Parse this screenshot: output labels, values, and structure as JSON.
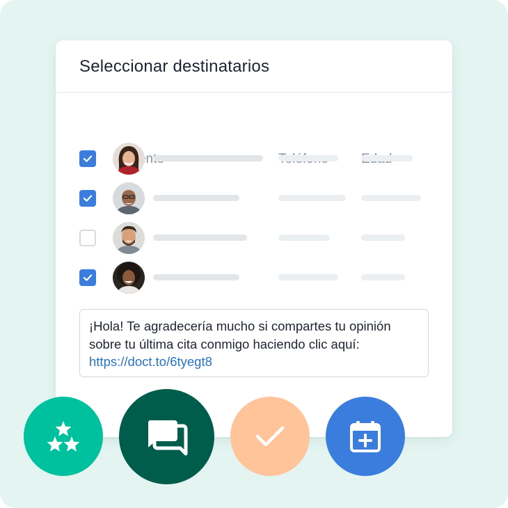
{
  "card": {
    "title": "Seleccionar destinatarios"
  },
  "table": {
    "headers": {
      "patient": "Paciente",
      "phone": "Teléfono",
      "age": "Edad"
    },
    "rows": [
      {
        "checked": true,
        "avatar": "woman-avatar"
      },
      {
        "checked": true,
        "avatar": "older-man-avatar"
      },
      {
        "checked": false,
        "avatar": "bearded-man-avatar"
      },
      {
        "checked": true,
        "avatar": "curly-hair-woman-avatar"
      }
    ]
  },
  "message": {
    "text_line1": "¡Hola! Te agradecería mucho si compartes tu opinión",
    "text_line2": "sobre tu última cita conmigo haciendo clic aquí:",
    "link": "https://doct.to/6tyegt8"
  },
  "actions": [
    {
      "name": "rating-stars-button",
      "icon": "stars-icon",
      "color": "#00c19d"
    },
    {
      "name": "chat-button",
      "icon": "chat-bubbles-icon",
      "color": "#005c4b"
    },
    {
      "name": "confirm-button",
      "icon": "checkmark-icon",
      "color": "#ffc49a"
    },
    {
      "name": "calendar-button",
      "icon": "calendar-plus-icon",
      "color": "#3b7ddd"
    }
  ],
  "colors": {
    "background": "#e4f5f1",
    "accent_blue": "#3b7ddd",
    "link": "#2773c4"
  }
}
